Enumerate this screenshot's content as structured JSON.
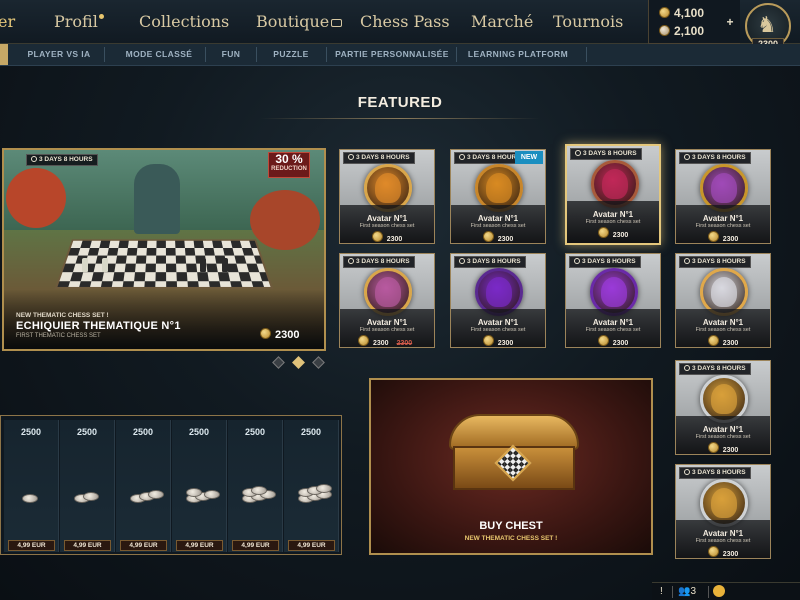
{
  "topnav": {
    "items": [
      {
        "label": "er"
      },
      {
        "label": "Profil"
      },
      {
        "label": "Collections"
      },
      {
        "label": "Boutique"
      },
      {
        "label": "Chess Pass"
      },
      {
        "label": "Marché"
      },
      {
        "label": "Tournois"
      }
    ],
    "active_index": 0
  },
  "currency": {
    "gold": "4,100",
    "silver": "2,100",
    "plus_label": "+"
  },
  "profile": {
    "avatar_glyph": "♞",
    "level": "2300"
  },
  "subnav": {
    "items": [
      "PLAYER VS IA",
      "MODE CLASSÉ",
      "FUN",
      "PUZZLE",
      "PARTIE PERSONNALISÉE",
      "LEARNING PLATFORM"
    ]
  },
  "featured_heading": "FEATURED",
  "hero": {
    "timer": "3 DAYS 8 HOURS",
    "discount_pct": "30 %",
    "discount_label": "REDUCTION",
    "kicker": "NEW THEMATIC CHESS SET !",
    "title": "ECHIQUIER THEMATIQUE N°1",
    "subtitle": "FIRST THEMATIC CHESS SET",
    "price": "2300"
  },
  "carousel": {
    "count": 3,
    "active_index": 1
  },
  "cards": [
    {
      "timer": "3 DAYS 8 HOURS",
      "title": "Avatar N°1",
      "sub": "First season chess set",
      "price": "2300",
      "old_price": "",
      "badge": "",
      "accent": "#e08a2a",
      "ring": "#d9a64a"
    },
    {
      "timer": "3 DAYS 8 HOURS",
      "title": "Avatar N°1",
      "sub": "First season chess set",
      "price": "2300",
      "old_price": "",
      "badge": "NEW",
      "accent": "#d88a22",
      "ring": "#c8862a"
    },
    {
      "timer": "3 DAYS 8 HOURS",
      "title": "Avatar N°1",
      "sub": "First season chess set",
      "price": "2300",
      "old_price": "",
      "badge": "",
      "accent": "#c02858",
      "ring": "#a85a3a"
    },
    {
      "timer": "3 DAYS 8 HOURS",
      "title": "Avatar N°1",
      "sub": "First season chess set",
      "price": "2300",
      "old_price": "",
      "badge": "",
      "accent": "#a04ab8",
      "ring": "#c8962a"
    },
    {
      "timer": "3 DAYS 8 HOURS",
      "title": "Avatar N°1",
      "sub": "First season chess set",
      "price": "2300",
      "old_price": "2300",
      "badge": "",
      "accent": "#b85aa0",
      "ring": "#d9a64a"
    },
    {
      "timer": "3 DAYS 8 HOURS",
      "title": "Avatar N°1",
      "sub": "First season chess set",
      "price": "2300",
      "old_price": "",
      "badge": "",
      "accent": "#7a2ac8",
      "ring": "#5a2a90"
    },
    {
      "timer": "3 DAYS 8 HOURS",
      "title": "Avatar N°1",
      "sub": "First season chess set",
      "price": "2300",
      "old_price": "",
      "badge": "",
      "accent": "#9a3ad8",
      "ring": "#6a2aa8"
    },
    {
      "timer": "3 DAYS 8 HOURS",
      "title": "Avatar N°1",
      "sub": "First season chess set",
      "price": "2300",
      "old_price": "",
      "badge": "",
      "accent": "#d8d8e0",
      "ring": "#e0a84a"
    },
    {
      "timer": "3 DAYS 8 HOURS",
      "title": "Avatar N°1",
      "sub": "First season chess set",
      "price": "2300",
      "old_price": "",
      "badge": "",
      "accent": "#d8a03a",
      "ring": "#cfd2d4"
    },
    {
      "timer": "3 DAYS 8 HOURS",
      "title": "Avatar N°1",
      "sub": "First season chess set",
      "price": "2300",
      "old_price": "",
      "badge": "",
      "accent": "#d8a03a",
      "ring": "#cfd2d4"
    }
  ],
  "packs": [
    {
      "amount": "2500",
      "price": "4,99 EUR",
      "coins": 1
    },
    {
      "amount": "2500",
      "price": "4,99 EUR",
      "coins": 2
    },
    {
      "amount": "2500",
      "price": "4,99 EUR",
      "coins": 3
    },
    {
      "amount": "2500",
      "price": "4,99 EUR",
      "coins": 4
    },
    {
      "amount": "2500",
      "price": "4,99 EUR",
      "coins": 5
    },
    {
      "amount": "2500",
      "price": "4,99 EUR",
      "coins": 6
    }
  ],
  "chest": {
    "title": "BUY CHEST",
    "subtitle": "NEW THEMATIC CHESS SET !"
  },
  "statusbar": {
    "friends_count": "3"
  },
  "colors": {
    "gold_accent": "#e0c27a",
    "frame": "#b08f4e",
    "new_badge": "#1a8ec0",
    "discount": "#6b1a1a"
  }
}
